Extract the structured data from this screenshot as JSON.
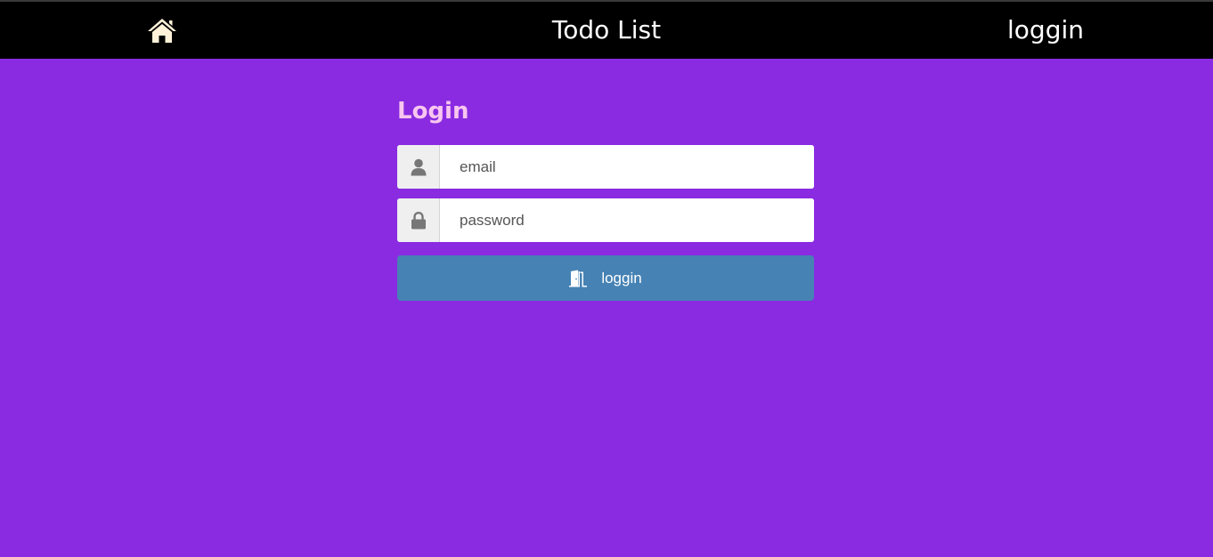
{
  "navbar": {
    "home_icon": "home-icon",
    "title": "Todo List",
    "login_link": "loggin"
  },
  "login_form": {
    "heading": "Login",
    "email": {
      "icon": "user-icon",
      "placeholder": "email",
      "value": ""
    },
    "password": {
      "icon": "lock-icon",
      "placeholder": "password",
      "value": ""
    },
    "submit": {
      "icon": "door-icon",
      "label": "loggin"
    }
  },
  "colors": {
    "page_background": "#8a2be2",
    "navbar_background": "#000000",
    "heading": "#f8c6ef",
    "button": "#4682b4",
    "home_icon": "#fff2d9"
  }
}
